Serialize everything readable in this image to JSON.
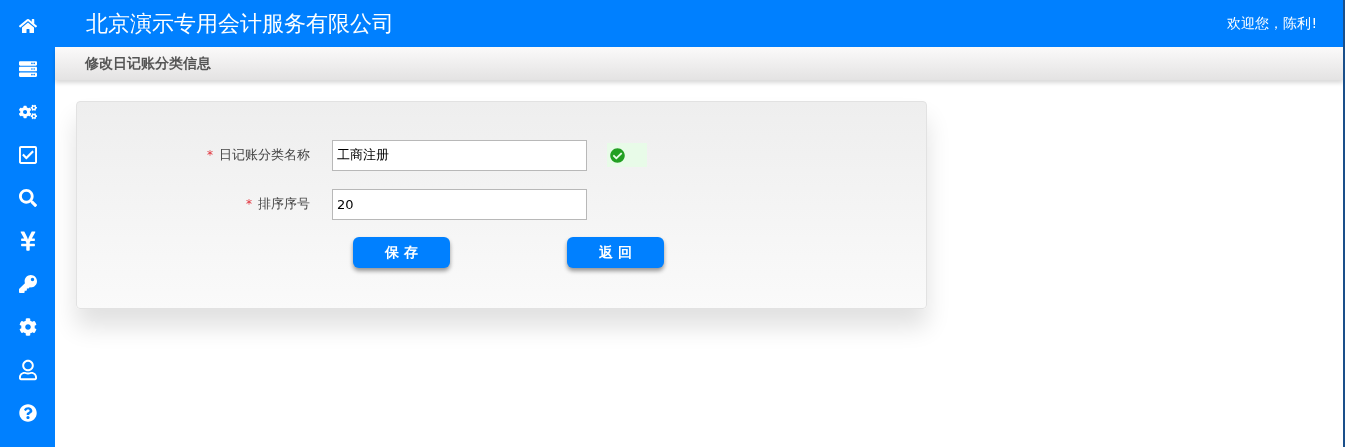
{
  "header": {
    "title": "北京演示专用会计服务有限公司",
    "welcome": "欢迎您，陈利!"
  },
  "page_title": "修改日记账分类信息",
  "form": {
    "fields": [
      {
        "required": true,
        "required_mark": "*",
        "label": "日记账分类名称",
        "value": "工商注册",
        "valid": true
      },
      {
        "required": true,
        "required_mark": "*",
        "label": "排序序号",
        "value": "20",
        "valid": false
      }
    ],
    "buttons": [
      {
        "label": "保 存"
      },
      {
        "label": "返 回"
      }
    ]
  }
}
